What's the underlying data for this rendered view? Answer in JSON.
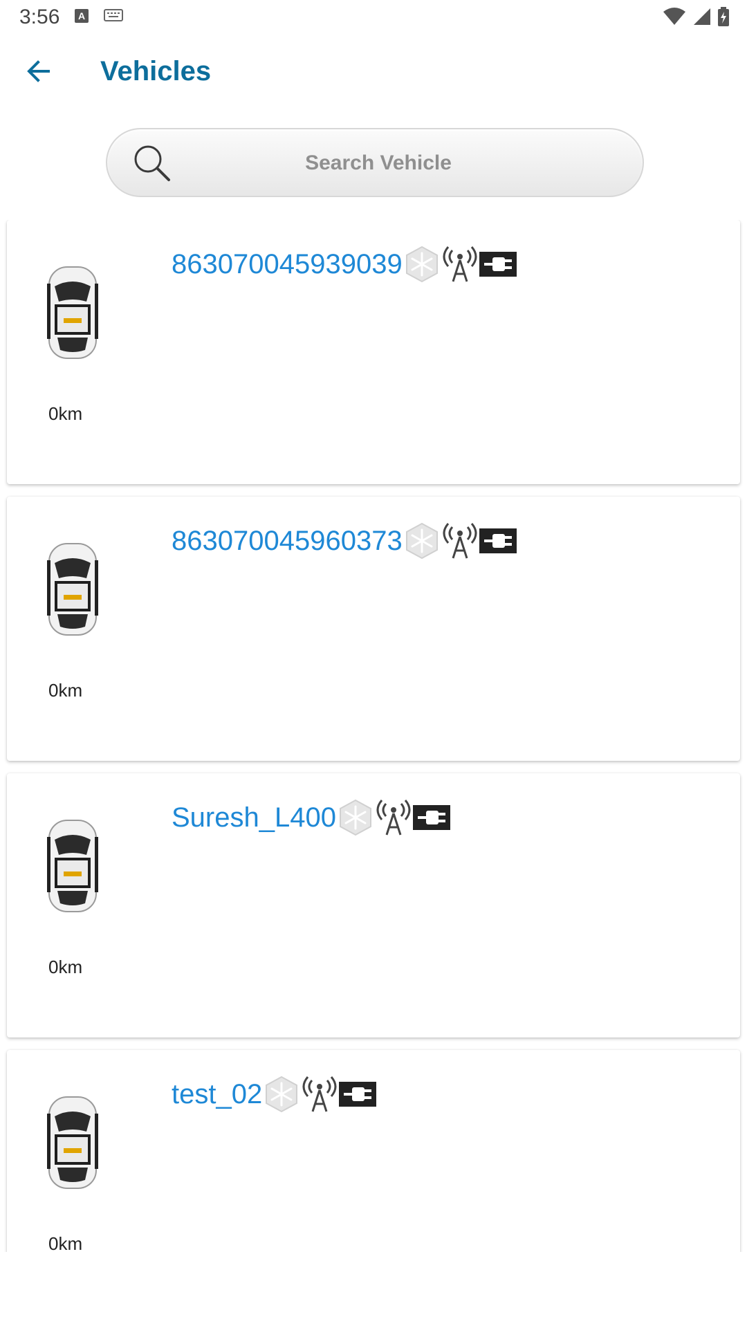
{
  "status_bar": {
    "time": "3:56",
    "a_badge": "A",
    "icons": [
      "keyboard-icon",
      "wifi-icon",
      "signal-icon",
      "battery-icon"
    ]
  },
  "app_bar": {
    "title": "Vehicles",
    "back_icon": "arrow-left-icon"
  },
  "search": {
    "placeholder": "Search Vehicle",
    "value": ""
  },
  "colors": {
    "accent": "#1e88d6",
    "title": "#0d6e9c"
  },
  "vehicles": [
    {
      "name": "863070045939039",
      "distance": "0km",
      "icons": [
        "snowflake-icon",
        "antenna-icon",
        "plug-icon"
      ]
    },
    {
      "name": "863070045960373",
      "distance": "0km",
      "icons": [
        "snowflake-icon",
        "antenna-icon",
        "plug-icon"
      ]
    },
    {
      "name": "Suresh_L400",
      "distance": "0km",
      "icons": [
        "snowflake-icon",
        "antenna-icon",
        "plug-icon"
      ]
    },
    {
      "name": "test_02",
      "distance": "0km",
      "icons": [
        "snowflake-icon",
        "antenna-icon",
        "plug-icon"
      ]
    }
  ]
}
